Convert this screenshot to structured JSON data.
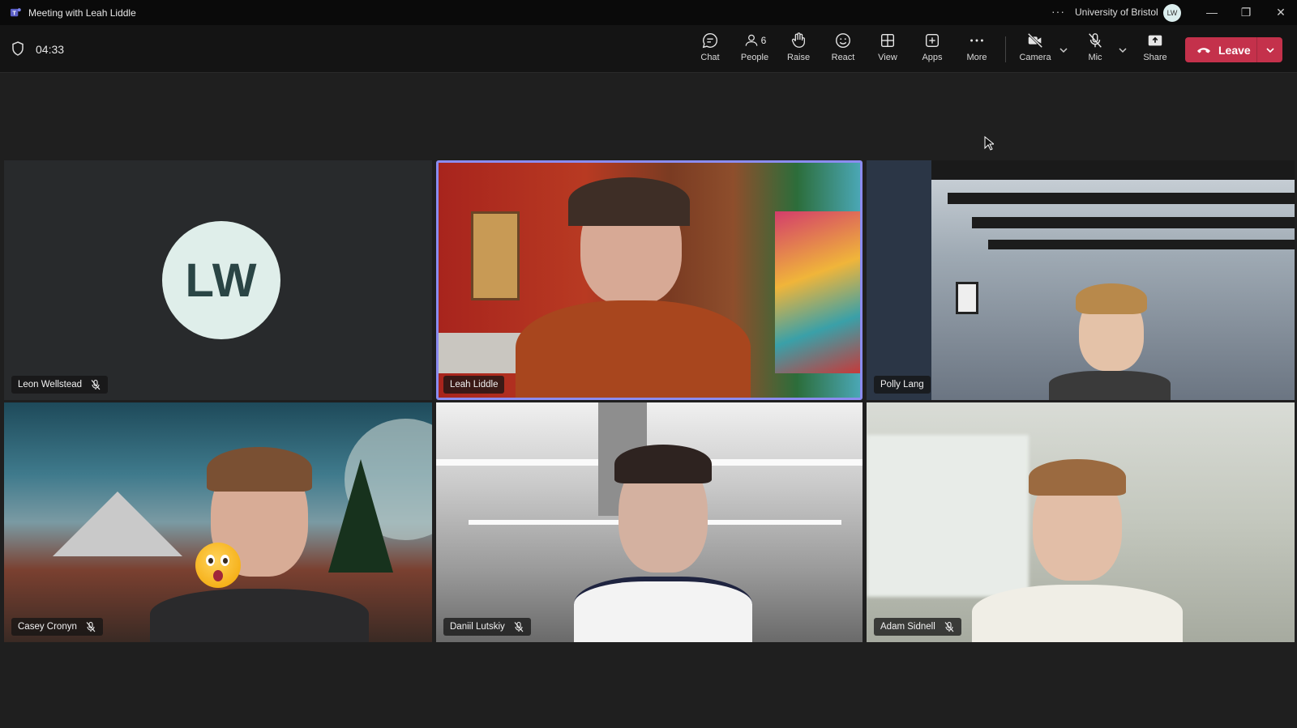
{
  "window": {
    "title": "Meeting with Leah Liddle",
    "organization": "University of Bristol",
    "account_initials": "LW",
    "more_glyph": "···",
    "minimize_glyph": "—",
    "restore_glyph": "❐",
    "close_glyph": "✕"
  },
  "toolbar": {
    "timer": "04:33",
    "people_count": "6",
    "items": {
      "chat": "Chat",
      "people": "People",
      "raise": "Raise",
      "react": "React",
      "view": "View",
      "apps": "Apps",
      "more": "More",
      "camera": "Camera",
      "mic": "Mic",
      "share": "Share"
    },
    "leave_label": "Leave"
  },
  "colors": {
    "leave": "#c4314b",
    "active_speaker_border": "#8b8cf0",
    "avatar_bg": "#dfeeea"
  },
  "participants": [
    {
      "name": "Leon Wellstead",
      "initials": "LW",
      "muted": true,
      "video": false
    },
    {
      "name": "Leah Liddle",
      "muted": false,
      "video": true,
      "active_speaker": true
    },
    {
      "name": "Polly Lang",
      "muted": false,
      "video": true
    },
    {
      "name": "Casey Cronyn",
      "muted": true,
      "video": true,
      "reaction": "surprised-emoji"
    },
    {
      "name": "Daniil Lutskiy",
      "muted": true,
      "video": true
    },
    {
      "name": "Adam Sidnell",
      "muted": true,
      "video": true
    }
  ]
}
